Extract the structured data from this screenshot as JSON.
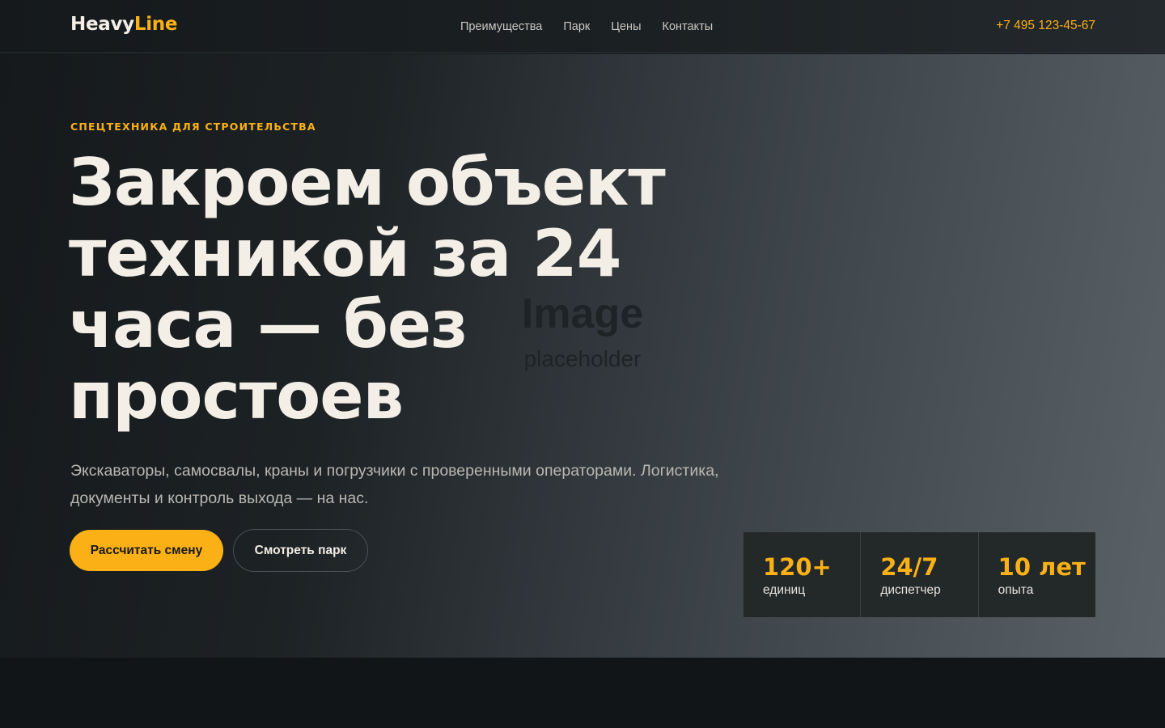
{
  "header": {
    "logo": {
      "part1": "Heavy",
      "part2": "Line"
    },
    "nav": [
      {
        "label": "Преимущества"
      },
      {
        "label": "Парк"
      },
      {
        "label": "Цены"
      },
      {
        "label": "Контакты"
      }
    ],
    "phone": "+7 495 123-45-67"
  },
  "hero": {
    "eyebrow": "СПЕЦТЕХНИКА ДЛЯ СТРОИТЕЛЬСТВА",
    "headline": "Закроем объект техникой за 24 часа — без простоев",
    "subtitle": "Экскаваторы, самосвалы, краны и погрузчики с проверенными операторами. Логистика, документы и контроль выхода — на нас.",
    "primary_button": "Рассчитать смену",
    "secondary_button": "Смотреть парк",
    "image_placeholder": {
      "main": "Image",
      "sub": "placeholder"
    },
    "stats": [
      {
        "value": "120+",
        "label": "единиц"
      },
      {
        "value": "24/7",
        "label": "диспетчер"
      },
      {
        "value": "10 лет",
        "label": "опыта"
      }
    ]
  },
  "colors": {
    "accent": "#fbb115",
    "text_light": "#f3eee6",
    "background_dark": "#111518"
  }
}
